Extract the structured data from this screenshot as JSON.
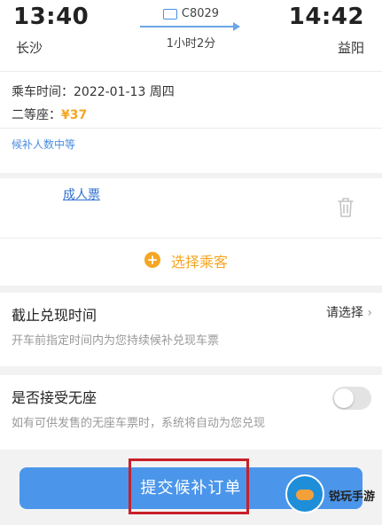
{
  "journey": {
    "depart_time": "13:40",
    "arrive_time": "14:42",
    "from": "长沙",
    "to": "益阳",
    "train_no": "C8029",
    "duration": "1小时2分"
  },
  "info": {
    "date_label": "乘车时间：",
    "date_value": "2022-01-13 周四",
    "seat_label": "二等座：",
    "price": "¥37",
    "wait_status": "候补人数中等"
  },
  "passenger": {
    "ticket_type": "成人票",
    "select_label": "选择乘客"
  },
  "deadline": {
    "title": "截止兑现时间",
    "action": "请选择",
    "description": "开车前指定时间内为您持续候补兑现车票"
  },
  "no_seat": {
    "title": "是否接受无座",
    "description": "如有可供发售的无座车票时，系统将自动为您兑现",
    "enabled": false
  },
  "submit_label": "提交候补订单",
  "watermark": {
    "text": "锐玩手游"
  },
  "colors": {
    "accent": "#4b96ea",
    "price": "#f5a623",
    "highlight": "#c8202a"
  }
}
